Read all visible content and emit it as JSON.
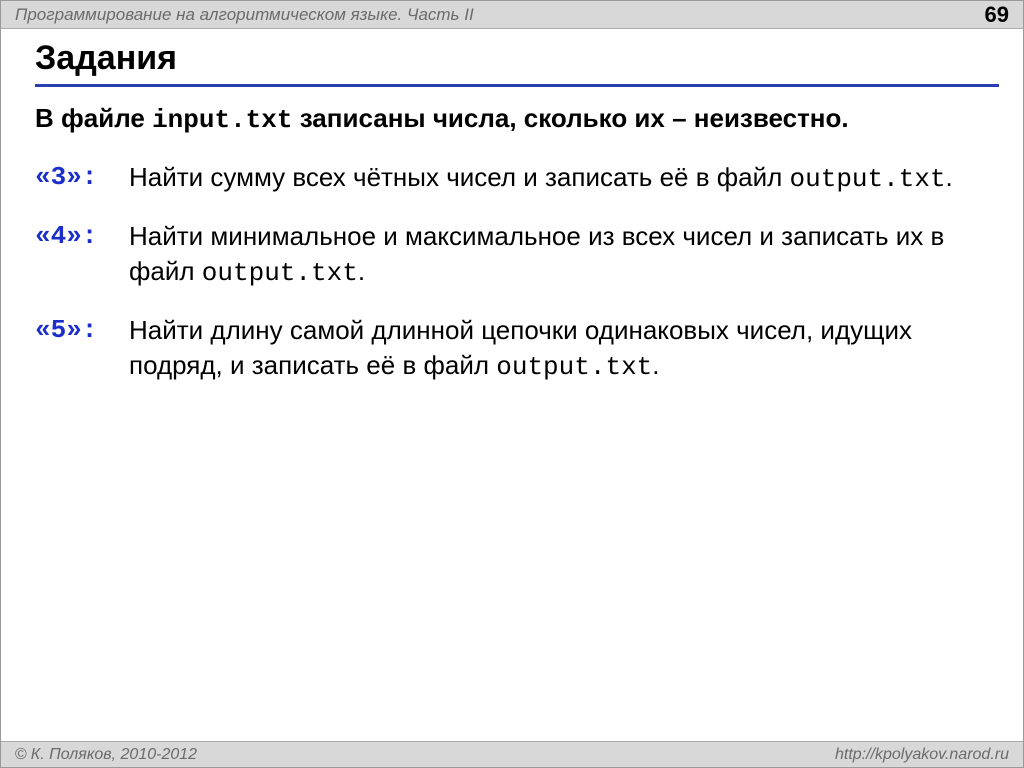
{
  "header": {
    "title": "Программирование на алгоритмическом языке. Часть II",
    "page": "69"
  },
  "heading": "Задания",
  "intro": {
    "before": "В файле ",
    "code": "input.txt",
    "after": " записаны числа, сколько их – неизвестно."
  },
  "tasks": [
    {
      "label": "«3»:",
      "before": "Найти сумму всех чётных чисел и записать её в файл ",
      "code": "output.txt",
      "after": "."
    },
    {
      "label": "«4»:",
      "before": "Найти минимальное и максимальное из всех чисел и записать их в файл ",
      "code": "output.txt",
      "after": "."
    },
    {
      "label": "«5»:",
      "before": "Найти длину самой длинной цепочки одинаковых чисел, идущих подряд, и записать её в файл ",
      "code": "output.txt",
      "after": "."
    }
  ],
  "footer": {
    "copyright_symbol": "©",
    "copyright": "К. Поляков, 2010-2012",
    "url": "http://kpolyakov.narod.ru"
  }
}
